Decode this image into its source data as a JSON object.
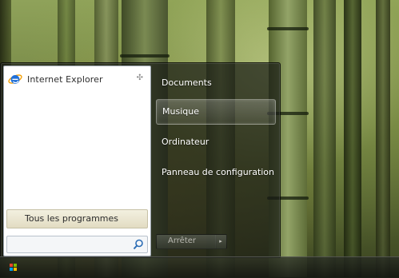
{
  "start_menu": {
    "pinned": [
      {
        "label": "Internet Explorer",
        "icon": "internet-explorer-icon"
      }
    ],
    "all_programs_label": "Tous les programmes",
    "search": {
      "placeholder": "",
      "icon": "search-icon"
    },
    "places": [
      {
        "label": "Documents",
        "selected": false
      },
      {
        "label": "Musique",
        "selected": true
      },
      {
        "label": "Ordinateur",
        "selected": false
      },
      {
        "label": "Panneau de configuration",
        "selected": false
      }
    ],
    "shutdown_label": "Arrêter",
    "shutdown_arrow": "▸"
  },
  "taskbar": {
    "start_icon": "windows-start-icon"
  },
  "colors": {
    "ie_blue": "#1e6fd9",
    "ie_orange": "#f2a20d",
    "selection": "#ffffff"
  }
}
